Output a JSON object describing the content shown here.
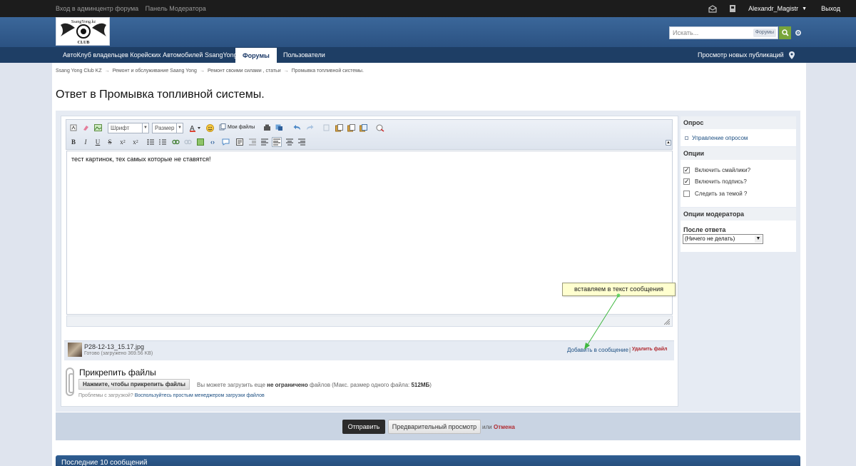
{
  "topbar": {
    "admin_link": "Вход в админцентр форума",
    "mod_link": "Панель Модератора",
    "username": "Alexandr_Magistr",
    "logout": "Выход"
  },
  "header": {
    "logo_text_top": "SsangYong.kz",
    "logo_text_bottom": "CLUB",
    "search_placeholder": "Искать...",
    "search_scope": "Форумы"
  },
  "nav": {
    "tabs": [
      {
        "label": "АвтоКлуб владельцев Корейских Автомобилей SsangYong"
      },
      {
        "label": "Форумы"
      },
      {
        "label": "Пользователи"
      }
    ],
    "new_posts": "Просмотр новых публикаций"
  },
  "breadcrumbs": [
    "Ssang Yong Club KZ",
    "Ремонт и обслуживание Saang Yong",
    "Ремонт своими силами , статьи",
    "Промывка топливной системы."
  ],
  "breadcrumb_sep": "→",
  "page_title": "Ответ в Промывка топливной системы.",
  "editor": {
    "font_select": "Шрифт",
    "size_select": "Размер",
    "my_files": "Мои файлы",
    "content": "тест картинок, тех самых которые не ставятся!"
  },
  "attachment": {
    "filename": "P28-12-13_15.17.jpg",
    "status": "Готово (загружено 369.56 KB)",
    "add_link": "Добавить в сообщение",
    "separator": "|",
    "delete_link": "Удалить файл"
  },
  "callout": "вставляем в текст сообщения",
  "upload": {
    "title": "Прикрепить файлы",
    "button": "Нажмите, чтобы прикрепить файлы",
    "info_prefix": "Вы можете загрузить еще ",
    "info_bold1": "не ограничено",
    "info_mid": " файлов (Макс. размер одного файла: ",
    "info_bold2": "512МБ",
    "info_suffix": ")",
    "problems_prefix": "Проблемы с загрузкой? ",
    "problems_link": "Воспользуйтесь простым менеджером загрузки файлов"
  },
  "sidebar": {
    "poll_header": "Опрос",
    "poll_link": "Управление опросом",
    "options_header": "Опции",
    "options": [
      {
        "label": "Включить смайлики?",
        "checked": true
      },
      {
        "label": "Включить подпись?",
        "checked": true
      },
      {
        "label": "Следить за темой ?",
        "checked": false
      }
    ],
    "mod_header": "Опции модератора",
    "after_label": "После ответа",
    "after_value": "(Ничего не делать)"
  },
  "submit": {
    "send": "Отправить",
    "preview": "Предварительный просмотр",
    "or": "или",
    "cancel": "Отмена"
  },
  "last10": "Последние 10 сообщений",
  "colors": {
    "header_blue": "#2b5282",
    "nav_dark": "#1e3e65",
    "link_blue": "#1d4f82",
    "cancel_red": "#b0292f",
    "search_green": "#78a53a"
  }
}
